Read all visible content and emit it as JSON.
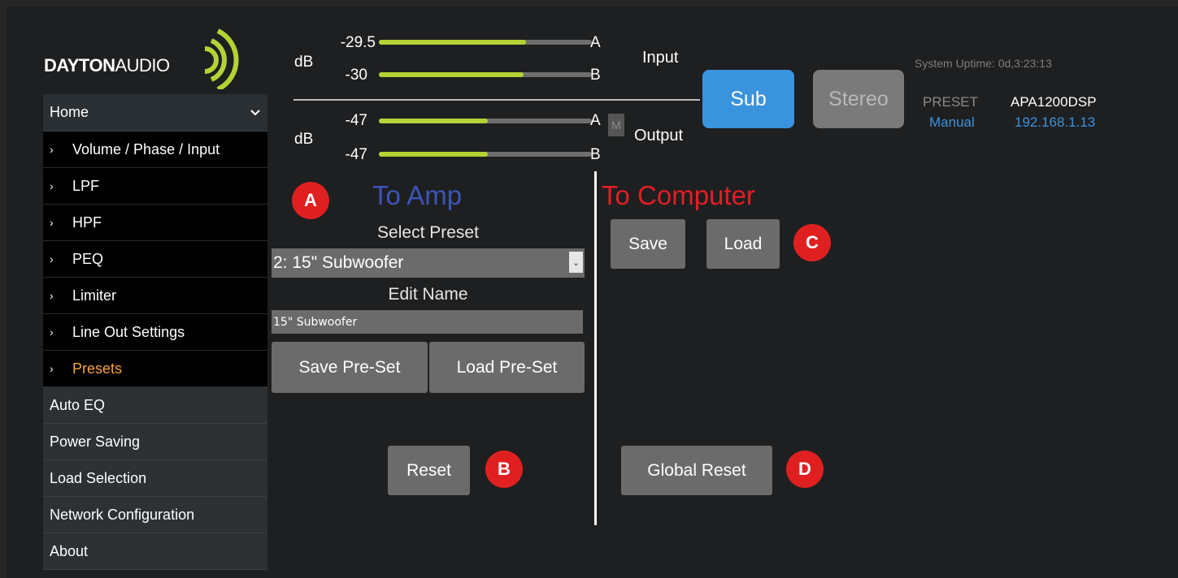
{
  "logo": {
    "brand_bold": "DAYTON",
    "brand_thin": "AUDIO"
  },
  "sidebar": {
    "home": {
      "label": "Home"
    },
    "sub_items": [
      {
        "label": "Volume / Phase / Input"
      },
      {
        "label": "LPF"
      },
      {
        "label": "HPF"
      },
      {
        "label": "PEQ"
      },
      {
        "label": "Limiter"
      },
      {
        "label": "Line Out Settings"
      },
      {
        "label": "Presets"
      }
    ],
    "items": [
      {
        "label": "Auto EQ"
      },
      {
        "label": "Power Saving"
      },
      {
        "label": "Load Selection"
      },
      {
        "label": "Network Configuration"
      },
      {
        "label": "About"
      }
    ]
  },
  "meters": {
    "unit": "dB",
    "input_label": "Input",
    "output_label": "Output",
    "input": [
      {
        "value": "-29.5",
        "channel": "A",
        "level": 0.69
      },
      {
        "value": "-30",
        "channel": "B",
        "level": 0.68
      }
    ],
    "output": [
      {
        "value": "-47",
        "channel": "A",
        "level": 0.51
      },
      {
        "value": "-47",
        "channel": "B",
        "level": 0.51
      }
    ],
    "mute_label": "M"
  },
  "mode": {
    "sub_label": "Sub",
    "stereo_label": "Stereo",
    "active": "Sub"
  },
  "status": {
    "uptime": "System Uptime: 0d,3:23:13",
    "preset_label": "PRESET",
    "device_name": "APA1200DSP",
    "preset_mode": "Manual",
    "ip": "192.168.1.13"
  },
  "to_amp": {
    "title": "To Amp",
    "select_label": "Select Preset",
    "selected_preset": "2: 15\" Subwoofer",
    "edit_name_label": "Edit Name",
    "name_value": "15\" Subwoofer",
    "save_label": "Save Pre-Set",
    "load_label": "Load Pre-Set",
    "reset_label": "Reset"
  },
  "to_computer": {
    "title": "To Computer",
    "save_label": "Save",
    "load_label": "Load",
    "global_reset_label": "Global Reset"
  },
  "badges": {
    "a": "A",
    "b": "B",
    "c": "C",
    "d": "D"
  },
  "colors": {
    "accent_blue": "#3a93dd",
    "meter_green": "#b3d335",
    "active_nav": "#f7a440",
    "amp_title": "#3c55b8",
    "computer_title": "#e31e24",
    "badge_red": "#e02020"
  }
}
